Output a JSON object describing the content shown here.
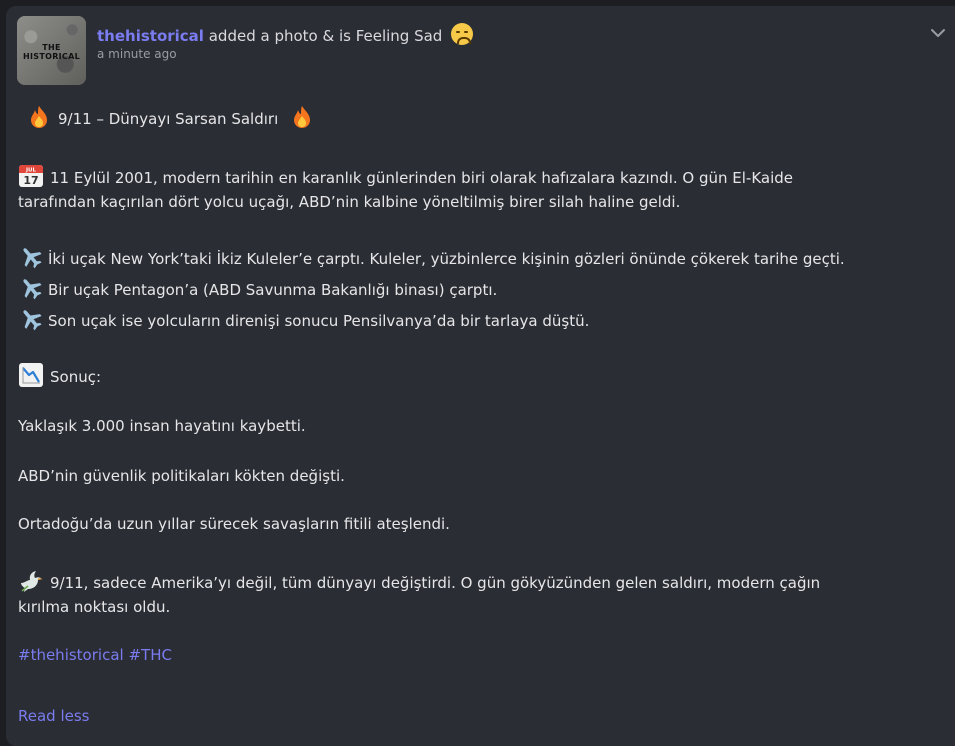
{
  "post": {
    "author": "thehistorical",
    "action": "added a photo & is Feeling Sad",
    "time": "a minute ago",
    "avatar_text": "THE HISTORICAL",
    "title": "9/11 – Dünyayı Sarsan Saldırı",
    "intro_line1": "11 Eylül 2001, modern tarihin en karanlık günlerinden biri olarak hafızalara kazındı. O gün El-Kaide",
    "intro_line2": "tarafından kaçırılan dört yolcu uçağı, ABD’nin kalbine yöneltilmiş birer silah haline geldi.",
    "plane1": "İki uçak New York’taki İkiz Kuleler’e çarptı. Kuleler, yüzbinlerce kişinin gözleri önünde çökerek tarihe geçti.",
    "plane2": "Bir uçak Pentagon’a (ABD Savunma Bakanlığı binası) çarptı.",
    "plane3": "Son uçak ise yolcuların direnişi sonucu Pensilvanya’da bir tarlaya düştü.",
    "result_heading": "Sonuç:",
    "result1": "Yaklaşık 3.000 insan hayatını kaybetti.",
    "result2": "ABD’nin güvenlik politikaları kökten değişti.",
    "result3": "Ortadoğu’da uzun yıllar sürecek savaşların fitili ateşlendi.",
    "closing_line1": "9/11, sadece Amerika’yı değil, tüm dünyayı değiştirdi. O gün gökyüzünden gelen saldırı, modern çağın",
    "closing_line2": "kırılma noktası oldu.",
    "hashtags": [
      "#thehistorical",
      "#THC"
    ],
    "read_less": "Read less",
    "calendar_month": "JUL",
    "calendar_day": "17"
  },
  "icons": {
    "feeling": "sad-face-icon",
    "title": "fire-icon",
    "intro": "calendar-icon",
    "planes": "airplane-icon",
    "result": "chart-decreasing-icon",
    "closing": "dove-icon",
    "menu": "chevron-down-icon"
  },
  "colors": {
    "background": "#1c1e22",
    "card": "#2a2d33",
    "link": "#7a7cf0",
    "text": "#e6e6e9",
    "muted": "#9a9ca3"
  }
}
